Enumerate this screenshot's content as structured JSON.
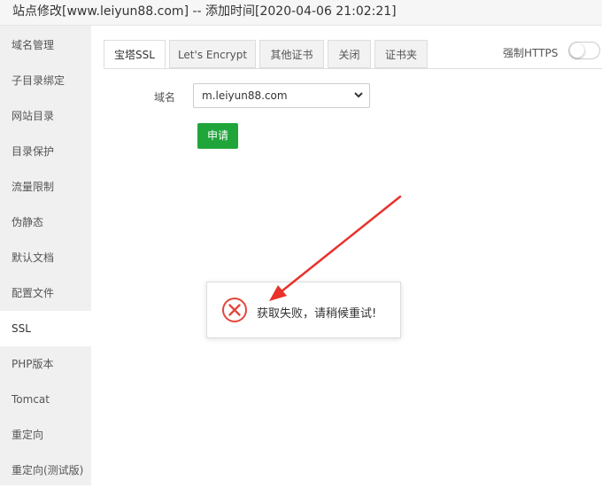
{
  "title": "站点修改[www.leiyun88.com] -- 添加时间[2020-04-06 21:02:21]",
  "sidebar": {
    "items": [
      {
        "label": "域名管理"
      },
      {
        "label": "子目录绑定"
      },
      {
        "label": "网站目录"
      },
      {
        "label": "目录保护"
      },
      {
        "label": "流量限制"
      },
      {
        "label": "伪静态"
      },
      {
        "label": "默认文档"
      },
      {
        "label": "配置文件"
      },
      {
        "label": "SSL"
      },
      {
        "label": "PHP版本"
      },
      {
        "label": "Tomcat"
      },
      {
        "label": "重定向"
      },
      {
        "label": "重定向(测试版)"
      }
    ],
    "active": "SSL"
  },
  "tabs": [
    {
      "label": "宝塔SSL"
    },
    {
      "label": "Let's Encrypt"
    },
    {
      "label": "其他证书"
    },
    {
      "label": "关闭"
    },
    {
      "label": "证书夹"
    }
  ],
  "force_https": {
    "label": "强制HTTPS",
    "enabled": false
  },
  "form": {
    "domain_label": "域名",
    "domain_value": "m.leiyun88.com",
    "apply_label": "申请"
  },
  "toast": {
    "message": "获取失败，请稍候重试!",
    "icon": "error-circle-x-icon"
  },
  "colors": {
    "accent_green": "#20a53a",
    "error_red": "#e2473c",
    "annotation_arrow": "#e8322b"
  },
  "annotation": {
    "type": "arrow",
    "color": "#e8322b"
  }
}
